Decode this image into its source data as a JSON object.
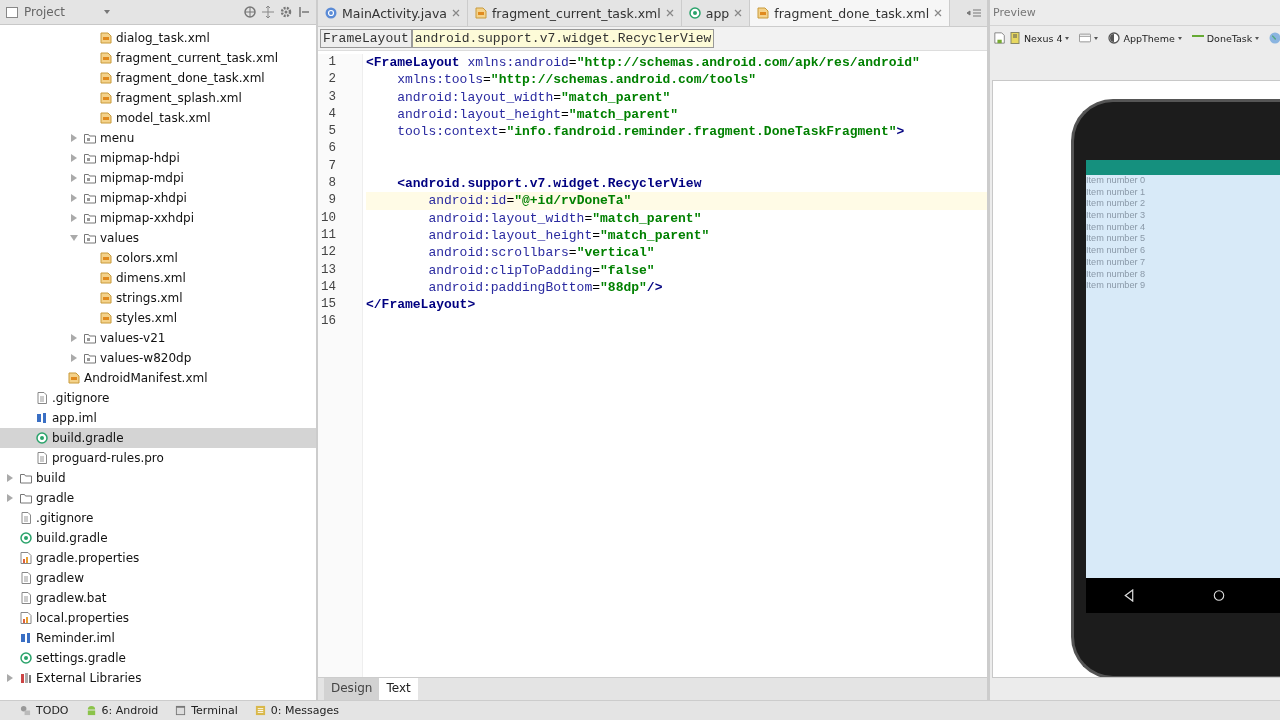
{
  "project_panel": {
    "title": "Project",
    "tree": [
      {
        "children": [
          {
            "children": [
              {
                "children": [
                  {
                    "children": [
                      {
                        "children": [
                          {
                            "label": "dialog_task.xml",
                            "kind": "xml",
                            "selected": false
                          },
                          {
                            "label": "fragment_current_task.xml",
                            "kind": "xml",
                            "selected": false
                          },
                          {
                            "label": "fragment_done_task.xml",
                            "kind": "xml",
                            "selected": false
                          },
                          {
                            "label": "fragment_splash.xml",
                            "kind": "xml",
                            "selected": false
                          },
                          {
                            "label": "model_task.xml",
                            "kind": "xml",
                            "selected": false
                          }
                        ]
                      },
                      {
                        "label": "menu",
                        "kind": "resfolder",
                        "expanded": false,
                        "selected": false
                      },
                      {
                        "label": "mipmap-hdpi",
                        "kind": "resfolder",
                        "expanded": false,
                        "selected": false
                      },
                      {
                        "label": "mipmap-mdpi",
                        "kind": "resfolder",
                        "expanded": false,
                        "selected": false
                      },
                      {
                        "label": "mipmap-xhdpi",
                        "kind": "resfolder",
                        "expanded": false,
                        "selected": false
                      },
                      {
                        "label": "mipmap-xxhdpi",
                        "kind": "resfolder",
                        "expanded": false,
                        "selected": false
                      },
                      {
                        "label": "values",
                        "kind": "resfolder",
                        "expanded": true,
                        "selected": false,
                        "children": [
                          {
                            "label": "colors.xml",
                            "kind": "xml",
                            "selected": false
                          },
                          {
                            "label": "dimens.xml",
                            "kind": "xml",
                            "selected": false
                          },
                          {
                            "label": "strings.xml",
                            "kind": "xml",
                            "selected": false
                          },
                          {
                            "label": "styles.xml",
                            "kind": "xml",
                            "selected": false
                          }
                        ]
                      },
                      {
                        "label": "values-v21",
                        "kind": "resfolder",
                        "expanded": false,
                        "selected": false
                      },
                      {
                        "label": "values-w820dp",
                        "kind": "resfolder",
                        "expanded": false,
                        "selected": false
                      }
                    ]
                  },
                  {
                    "label": "AndroidManifest.xml",
                    "kind": "xml",
                    "selected": false
                  }
                ]
              }
            ]
          },
          {
            "label": ".gitignore",
            "kind": "text",
            "selected": false
          },
          {
            "label": "app.iml",
            "kind": "iml",
            "selected": false
          },
          {
            "label": "build.gradle",
            "kind": "gradle",
            "selected": true
          },
          {
            "label": "proguard-rules.pro",
            "kind": "text",
            "selected": false
          }
        ]
      },
      {
        "label": "build",
        "kind": "folder",
        "expanded": false,
        "selected": false
      },
      {
        "label": "gradle",
        "kind": "folder",
        "expanded": false,
        "selected": false
      },
      {
        "label": ".gitignore",
        "kind": "text",
        "selected": false
      },
      {
        "label": "build.gradle",
        "kind": "gradle",
        "selected": false
      },
      {
        "label": "gradle.properties",
        "kind": "properties",
        "selected": false
      },
      {
        "label": "gradlew",
        "kind": "text",
        "selected": false
      },
      {
        "label": "gradlew.bat",
        "kind": "text",
        "selected": false
      },
      {
        "label": "local.properties",
        "kind": "properties",
        "selected": false
      },
      {
        "label": "Reminder.iml",
        "kind": "iml",
        "selected": false
      },
      {
        "label": "settings.gradle",
        "kind": "gradle",
        "selected": false
      },
      {
        "label": "External Libraries",
        "kind": "library",
        "expanded": false,
        "selected": false
      }
    ]
  },
  "editor": {
    "tabs": [
      {
        "label": "MainActivity.java",
        "kind": "java",
        "selected": false
      },
      {
        "label": "fragment_current_task.xml",
        "kind": "xml",
        "selected": false
      },
      {
        "label": "app",
        "kind": "module",
        "selected": false
      },
      {
        "label": "fragment_done_task.xml",
        "kind": "xml",
        "selected": true
      }
    ],
    "breadcrumbs": [
      {
        "label": "FrameLayout",
        "selected": false
      },
      {
        "label": "android.support.v7.widget.RecyclerView",
        "selected": true
      }
    ],
    "lines": [
      {
        "number": "1",
        "current": false,
        "tokens": [
          {
            "kind": "open",
            "text": "<FrameLayout"
          },
          {
            "kind": "attr",
            "text": "xmlns:android"
          },
          {
            "kind": "eq",
            "text": "="
          },
          {
            "kind": "value",
            "text": "\"http://schemas.android.com/apk/res/android\""
          }
        ]
      },
      {
        "number": "2",
        "current": false,
        "tokens": [
          {
            "kind": "attr",
            "text": "xmlns:tools"
          },
          {
            "kind": "eq",
            "text": "="
          },
          {
            "kind": "value",
            "text": "\"http://schemas.android.com/tools\""
          }
        ]
      },
      {
        "number": "3",
        "current": false,
        "tokens": [
          {
            "kind": "attr",
            "text": "android:layout_width"
          },
          {
            "kind": "eq",
            "text": "="
          },
          {
            "kind": "value",
            "text": "\"match_parent\""
          }
        ]
      },
      {
        "number": "4",
        "current": false,
        "tokens": [
          {
            "kind": "attr",
            "text": "android:layout_height"
          },
          {
            "kind": "eq",
            "text": "="
          },
          {
            "kind": "value",
            "text": "\"match_parent\""
          }
        ]
      },
      {
        "number": "5",
        "current": false,
        "tokens": [
          {
            "kind": "attr",
            "text": "tools:context"
          },
          {
            "kind": "eq",
            "text": "="
          },
          {
            "kind": "value",
            "text": "\"info.fandroid.reminder.fragment.DoneTaskFragment\""
          },
          {
            "kind": "tag_end",
            "text": ">"
          }
        ]
      },
      {
        "number": "6",
        "current": false
      },
      {
        "number": "7",
        "current": false
      },
      {
        "number": "8",
        "current": false,
        "tokens": [
          {
            "kind": "open",
            "text": "<android.support.v7.widget.RecyclerView"
          }
        ]
      },
      {
        "number": "9",
        "current": true,
        "tokens": [
          {
            "kind": "attr",
            "text": "android:id"
          },
          {
            "kind": "eq",
            "text": "="
          },
          {
            "kind": "value",
            "text": "\"@+id/rvDoneTa\""
          }
        ]
      },
      {
        "number": "10",
        "current": false,
        "tokens": [
          {
            "kind": "attr",
            "text": "android:layout_width"
          },
          {
            "kind": "eq",
            "text": "="
          },
          {
            "kind": "value",
            "text": "\"match_parent\""
          }
        ]
      },
      {
        "number": "11",
        "current": false,
        "tokens": [
          {
            "kind": "attr",
            "text": "android:layout_height"
          },
          {
            "kind": "eq",
            "text": "="
          },
          {
            "kind": "value",
            "text": "\"match_parent\""
          }
        ]
      },
      {
        "number": "12",
        "current": false,
        "tokens": [
          {
            "kind": "attr",
            "text": "android:scrollbars"
          },
          {
            "kind": "eq",
            "text": "="
          },
          {
            "kind": "value",
            "text": "\"vertical\""
          }
        ]
      },
      {
        "number": "13",
        "current": false,
        "tokens": [
          {
            "kind": "attr",
            "text": "android:clipToPadding"
          },
          {
            "kind": "eq",
            "text": "="
          },
          {
            "kind": "value",
            "text": "\"false\""
          }
        ]
      },
      {
        "number": "14",
        "current": false,
        "tokens": [
          {
            "kind": "attr",
            "text": "android:paddingBottom"
          },
          {
            "kind": "eq",
            "text": "="
          },
          {
            "kind": "value",
            "text": "\"88dp\""
          },
          {
            "kind": "self_close",
            "text": "/>"
          }
        ]
      },
      {
        "number": "15",
        "current": false,
        "tokens": [
          {
            "kind": "close",
            "text": "</FrameLayout>"
          }
        ]
      },
      {
        "number": "16",
        "current": false
      }
    ],
    "mode_tabs": [
      {
        "label": "Design",
        "selected": false
      },
      {
        "label": "Text",
        "selected": true
      }
    ]
  },
  "preview": {
    "title": "Preview",
    "toolbar": [
      {
        "label": "Nexus 4",
        "kind": "device"
      },
      {
        "kind": "orientation"
      },
      {
        "label": "AppTheme",
        "kind": "theme"
      },
      {
        "label": "DoneTask",
        "kind": "activity"
      },
      {
        "kind": "locale"
      }
    ],
    "screen_items": [
      "Item number 0",
      "Item number 1",
      "Item number 2",
      "Item number 3",
      "Item number 4",
      "Item number 5",
      "Item number 6",
      "Item number 7",
      "Item number 8",
      "Item number 9"
    ]
  },
  "status_bar": [
    {
      "label": "TODO",
      "kind": "todo"
    },
    {
      "label": "6: Android",
      "kind": "android"
    },
    {
      "label": "Terminal",
      "kind": "terminal"
    },
    {
      "label": "0: Messages",
      "kind": "messages"
    }
  ]
}
